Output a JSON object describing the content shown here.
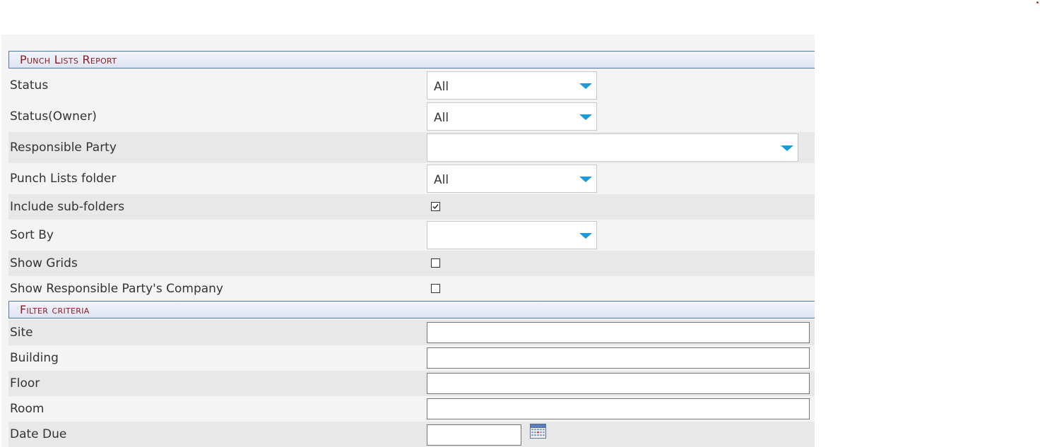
{
  "report_section": {
    "title": "Punch Lists Report",
    "fields": [
      {
        "label": "Status",
        "type": "select",
        "value": "All"
      },
      {
        "label": "Status(Owner)",
        "type": "select",
        "value": "All"
      },
      {
        "label": "Responsible Party",
        "type": "select",
        "value": ""
      },
      {
        "label": "Punch Lists folder",
        "type": "select",
        "value": "All"
      },
      {
        "label": "Include sub-folders",
        "type": "checkbox",
        "checked": true
      },
      {
        "label": "Sort By",
        "type": "select",
        "value": ""
      },
      {
        "label": "Show Grids",
        "type": "checkbox",
        "checked": false
      },
      {
        "label": "Show Responsible Party's Company",
        "type": "checkbox",
        "checked": false
      }
    ]
  },
  "filter_section": {
    "title": "Filter criteria",
    "fields": [
      {
        "label": "Site",
        "type": "text",
        "value": ""
      },
      {
        "label": "Building",
        "type": "text",
        "value": ""
      },
      {
        "label": "Floor",
        "type": "text",
        "value": ""
      },
      {
        "label": "Room",
        "type": "text",
        "value": ""
      },
      {
        "label": "Date Due",
        "type": "date",
        "value": ""
      }
    ]
  },
  "icons": {
    "dropdown_arrow": "chevron-down-icon",
    "calendar": "calendar-icon"
  },
  "colors": {
    "section_title": "#8b1a1a",
    "dropdown_arrow": "#1a9ad6",
    "header_border": "#5577a8"
  }
}
